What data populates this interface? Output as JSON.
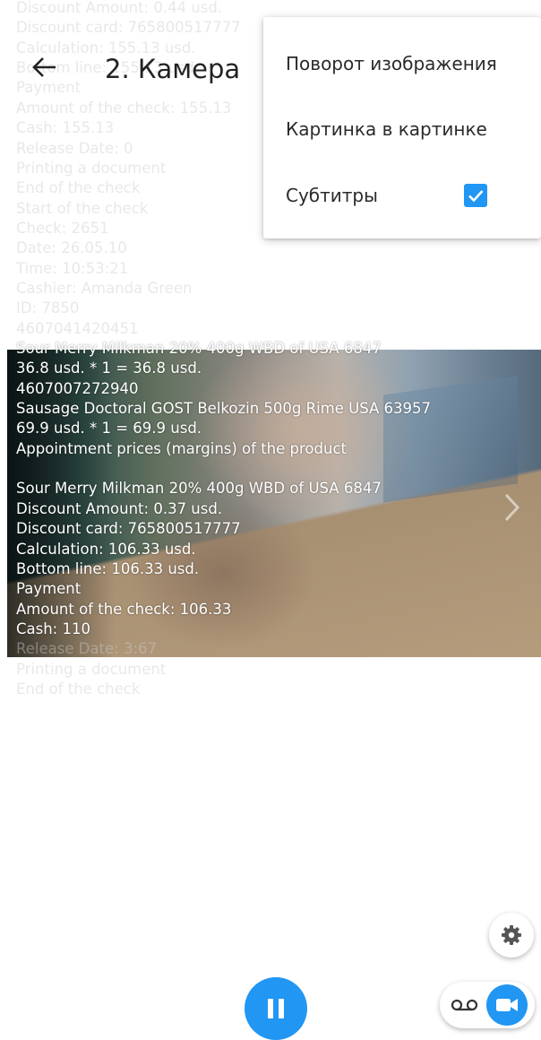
{
  "header": {
    "back_icon": "arrow-left-icon",
    "title": "2. Камера"
  },
  "menu": {
    "items": [
      {
        "label": "Поворот изображения"
      },
      {
        "label": "Картинка в картинке"
      },
      {
        "label": "Субтитры",
        "checked": true
      }
    ],
    "accent_color": "#2196f3"
  },
  "receipt_lines": [
    {
      "text": "Discount Amount: 0.44 usd.",
      "style": "faded"
    },
    {
      "text": "Discount card: 765800517777",
      "style": "faded"
    },
    {
      "text": "Calculation: 155.13 usd.",
      "style": "faded"
    },
    {
      "text": "Bottom line: 155.13 usd.",
      "style": "faded"
    },
    {
      "text": "Payment",
      "style": "faded"
    },
    {
      "text": "Amount of the check: 155.13",
      "style": "faded"
    },
    {
      "text": "Cash: 155.13",
      "style": "faded"
    },
    {
      "text": "Release Date: 0",
      "style": "faded"
    },
    {
      "text": "Printing a document",
      "style": "faded"
    },
    {
      "text": "End of the check",
      "style": "faded"
    },
    {
      "text": "Start of the check",
      "style": "faded"
    },
    {
      "text": " Check: 2651",
      "style": "faded"
    },
    {
      "text": " Date: 26.05.10",
      "style": "faded"
    },
    {
      "text": " Time: 10:53:21",
      "style": "faded"
    },
    {
      "text": " Cashier: Amanda Green",
      "style": "faded"
    },
    {
      "text": " ID: 7850",
      "style": "faded"
    },
    {
      "text": " 4607041420451",
      "style": "faded"
    },
    {
      "text": " Sour Merry Milkman 20% 400g WBD of USA 6847",
      "style": "bright"
    },
    {
      "text": " 36.8 usd. * 1 = 36.8 usd.",
      "style": "bright"
    },
    {
      "text": " 4607007272940",
      "style": "bright"
    },
    {
      "text": " Sausage Doctoral GOST Belkozin 500g Rime USA 63957",
      "style": "bright"
    },
    {
      "text": " 69.9 usd. * 1 = 69.9 usd.",
      "style": "bright"
    },
    {
      "text": "Appointment prices (margins) of the product",
      "style": "bright"
    },
    {
      "text": "",
      "style": "bright"
    },
    {
      "text": "  Sour Merry Milkman 20% 400g WBD of USA 6847",
      "style": "bright"
    },
    {
      "text": "Discount Amount: 0.37 usd.",
      "style": "bright"
    },
    {
      "text": "Discount card: 765800517777",
      "style": "bright"
    },
    {
      "text": "Calculation: 106.33 usd.",
      "style": "bright"
    },
    {
      "text": "Bottom line: 106.33 usd.",
      "style": "bright"
    },
    {
      "text": "Payment",
      "style": "bright"
    },
    {
      "text": "Amount of the check: 106.33",
      "style": "bright"
    },
    {
      "text": "Cash: 110",
      "style": "bright"
    },
    {
      "text": "Release Date: 3:67",
      "style": "faded"
    },
    {
      "text": "Printing a document",
      "style": "faded"
    },
    {
      "text": "End of the check",
      "style": "faded"
    }
  ],
  "video": {
    "next_icon": "chevron-right-icon"
  },
  "controls": {
    "settings_icon": "gear-icon",
    "pause_icon": "pause-icon",
    "audio_mode_icon": "voicemail-icon",
    "video_mode_icon": "videocam-icon",
    "active_mode": "video",
    "accent_color": "#2196f3"
  }
}
